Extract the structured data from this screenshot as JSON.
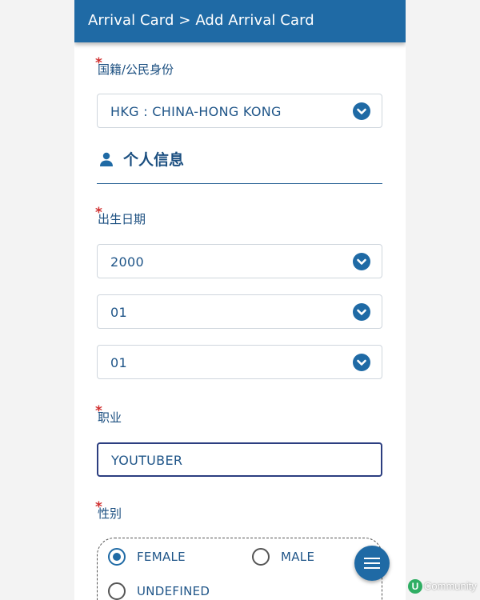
{
  "appbar": {
    "title": "Arrival Card > Add Arrival Card"
  },
  "nationality": {
    "label": "国籍/公民身份",
    "required_mark": "*",
    "value": "HKG : CHINA-HONG KONG"
  },
  "personal_section": {
    "title": "个人信息",
    "icon": "person-icon"
  },
  "birth_date": {
    "label": "出生日期",
    "required_mark": "*",
    "year": "2000",
    "month": "01",
    "day": "01"
  },
  "occupation": {
    "label": "职业",
    "required_mark": "*",
    "value": "YOUTUBER"
  },
  "gender": {
    "label": "性别",
    "required_mark": "*",
    "options": [
      {
        "label": "FEMALE",
        "selected": true
      },
      {
        "label": "MALE",
        "selected": false
      },
      {
        "label": "UNDEFINED",
        "selected": false
      }
    ]
  },
  "fab": {
    "icon": "menu-icon"
  },
  "watermark": {
    "badge": "U",
    "text": "Community"
  },
  "colors": {
    "primary": "#1f6aa5",
    "label": "#1b4f80",
    "required": "#d03030"
  }
}
